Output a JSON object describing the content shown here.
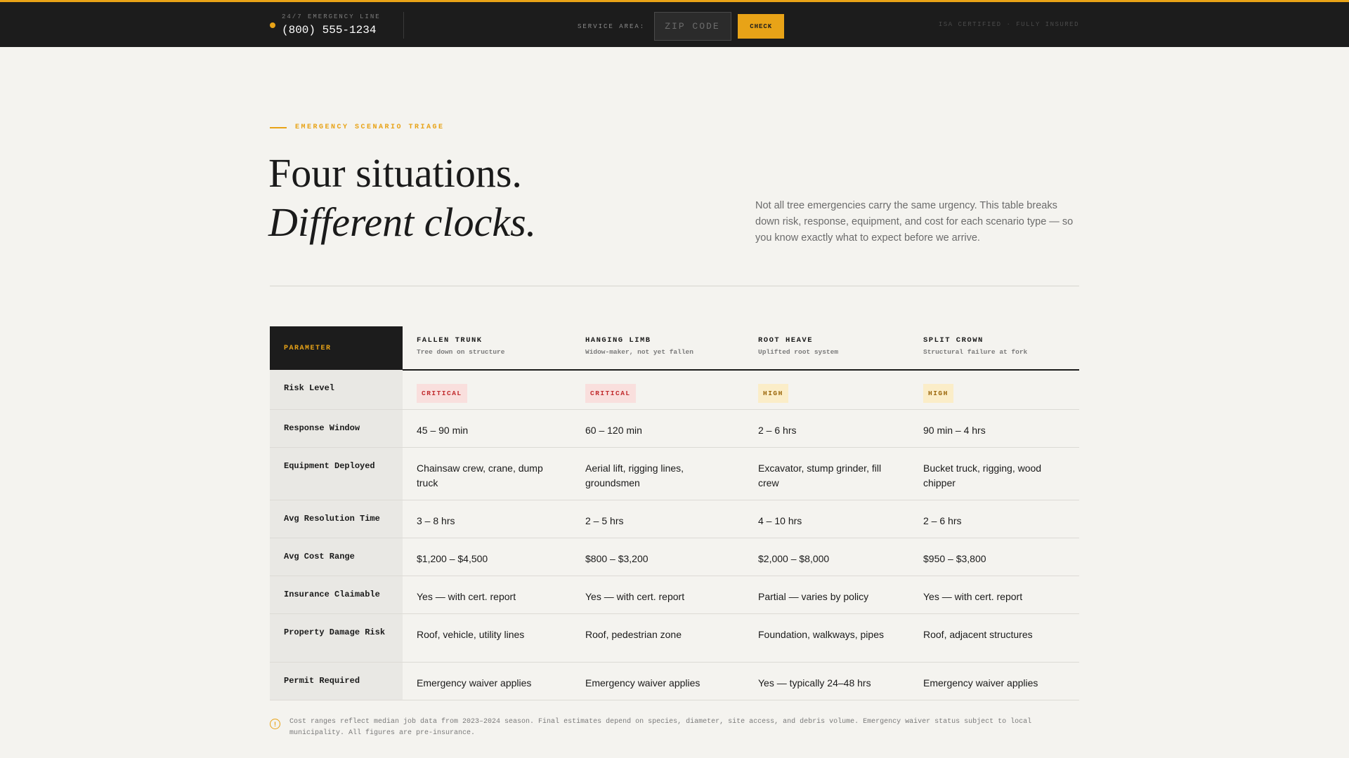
{
  "topbar": {
    "emergency_label": "24/7 EMERGENCY LINE",
    "phone": "(800) 555-1234",
    "service_label": "SERVICE AREA:",
    "zip_placeholder": "ZIP CODE",
    "check_label": "CHECK",
    "certified": "ISA CERTIFIED · FULLY INSURED"
  },
  "hero": {
    "eyebrow": "EMERGENCY SCENARIO TRIAGE",
    "title_line1": "Four situations.",
    "title_line2": "Different clocks.",
    "intro": "Not all tree emergencies carry the same urgency. This table breaks down risk, response, equipment, and cost for each scenario type — so you know exactly what to expect before we arrive."
  },
  "table": {
    "param_header": "PARAMETER",
    "scenarios": [
      {
        "name": "FALLEN TRUNK",
        "sub": "Tree down on structure"
      },
      {
        "name": "HANGING LIMB",
        "sub": "Widow-maker, not yet fallen"
      },
      {
        "name": "ROOT HEAVE",
        "sub": "Uplifted root system"
      },
      {
        "name": "SPLIT CROWN",
        "sub": "Structural failure at fork"
      }
    ],
    "rows": {
      "risk": {
        "label": "Risk Level",
        "values": [
          "CRITICAL",
          "CRITICAL",
          "HIGH",
          "HIGH"
        ]
      },
      "response": {
        "label": "Response Window",
        "values": [
          "45 – 90 min",
          "60 – 120 min",
          "2 – 6 hrs",
          "90 min – 4 hrs"
        ]
      },
      "equipment": {
        "label": "Equipment Deployed",
        "values": [
          "Chainsaw crew, crane, dump truck",
          "Aerial lift, rigging lines, groundsmen",
          "Excavator, stump grinder, fill crew",
          "Bucket truck, rigging, wood chipper"
        ]
      },
      "resolution": {
        "label": "Avg Resolution Time",
        "values": [
          "3 – 8 hrs",
          "2 – 5 hrs",
          "4 – 10 hrs",
          "2 – 6 hrs"
        ]
      },
      "cost": {
        "label": "Avg Cost Range",
        "values": [
          "$1,200 – $4,500",
          "$800 – $3,200",
          "$2,000 – $8,000",
          "$950 – $3,800"
        ]
      },
      "insurance": {
        "label": "Insurance Claimable",
        "values": [
          "Yes — with cert. report",
          "Yes — with cert. report",
          "Partial — varies by policy",
          "Yes — with cert. report"
        ]
      },
      "property": {
        "label": "Property Damage Risk",
        "values": [
          "Roof, vehicle, utility lines",
          "Roof, pedestrian zone",
          "Foundation, walkways, pipes",
          "Roof, adjacent structures"
        ]
      },
      "permit": {
        "label": "Permit Required",
        "values": [
          "Emergency waiver applies",
          "Emergency waiver applies",
          "Yes — typically 24–48 hrs",
          "Emergency waiver applies"
        ]
      }
    }
  },
  "footnote": {
    "icon": "info-icon",
    "text": "Cost ranges reflect median job data from 2023–2024 season. Final estimates depend on species, diameter, site access, and debris volume. Emergency waiver status subject to local municipality. All figures are pre-insurance."
  },
  "colors": {
    "accent": "#e8a317",
    "critical": "#c0282a",
    "high": "#9a6508",
    "dark": "#1c1c1c",
    "background": "#f4f3ef"
  }
}
